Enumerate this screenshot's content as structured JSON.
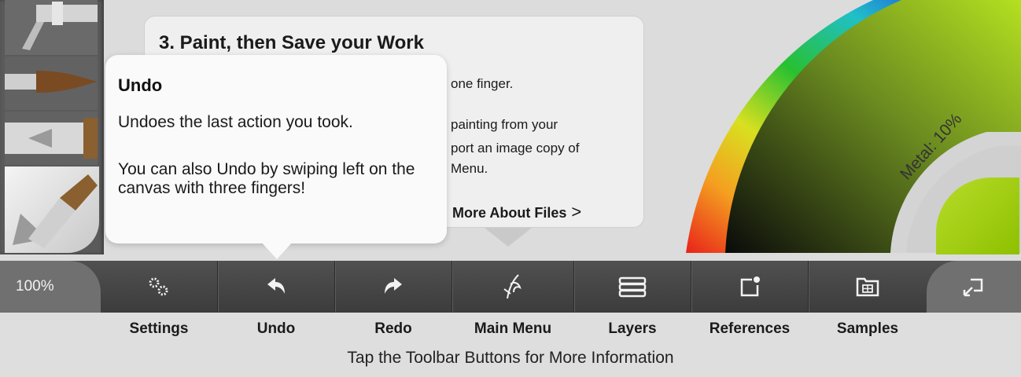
{
  "info_card": {
    "title": "3. Paint, then Save your Work",
    "line1": "one finger.",
    "line2": "painting from your",
    "line3": "port an image copy of",
    "line4": "Menu.",
    "more_link": "More About Files",
    "more_chevron": ">"
  },
  "tooltip": {
    "title": "Undo",
    "text1": "Undoes the last action you took.",
    "text2": "You can also Undo by swiping left on the canvas with three fingers!"
  },
  "color_picker": {
    "metal_label": "Metal: 10%",
    "current_color": "#9ccb12"
  },
  "toolbar": {
    "zoom": "100%",
    "buttons": [
      {
        "label": "Settings",
        "icon": "gears-icon"
      },
      {
        "label": "Undo",
        "icon": "undo-arrow-icon"
      },
      {
        "label": "Redo",
        "icon": "redo-arrow-icon"
      },
      {
        "label": "Main Menu",
        "icon": "main-menu-icon"
      },
      {
        "label": "Layers",
        "icon": "layers-icon"
      },
      {
        "label": "References",
        "icon": "references-icon"
      },
      {
        "label": "Samples",
        "icon": "samples-icon"
      }
    ],
    "fullscreen_icon": "fullscreen-icon"
  },
  "hint": "Tap the Toolbar Buttons for More Information",
  "colors": {
    "toolbar_bg": "#474747",
    "tooltip_bg": "#fafafa",
    "card_bg": "#efefef",
    "accent_green": "#9ccb12"
  }
}
